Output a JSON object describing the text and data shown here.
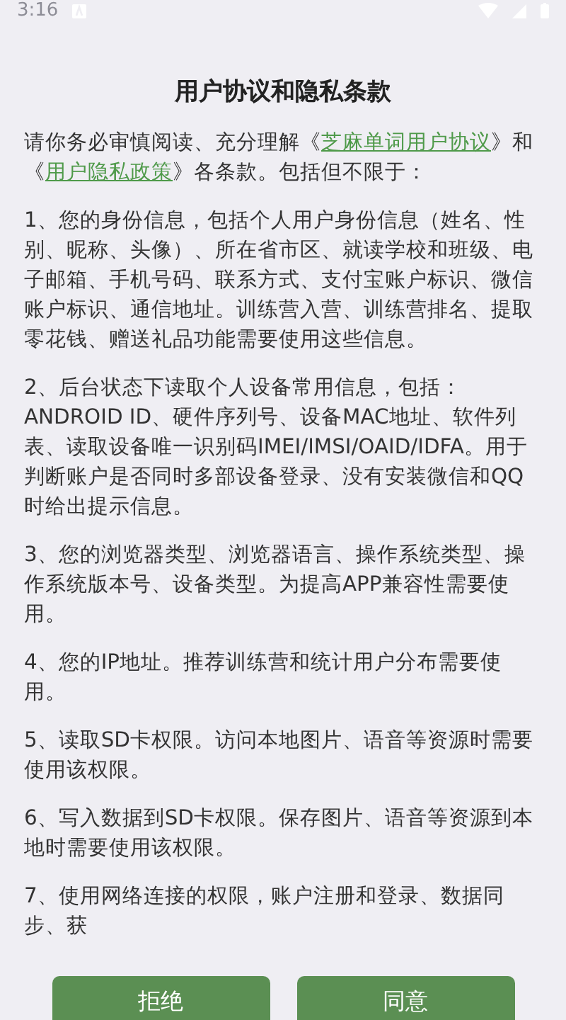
{
  "status_bar": {
    "time": "3:16"
  },
  "title": "用户协议和隐私条款",
  "intro": [
    {
      "kind": "text",
      "text": "请你务必审慎阅读、充分理解《"
    },
    {
      "kind": "link",
      "text": "芝麻单词用户协议"
    },
    {
      "kind": "text",
      "text": "》和《"
    },
    {
      "kind": "link",
      "text": "用户隐私政策"
    },
    {
      "kind": "text",
      "text": "》各条款。包括但不限于："
    }
  ],
  "paragraphs": [
    "1、您的身份信息，包括个人用户身份信息（姓名、性别、昵称、头像）、所在省市区、就读学校和班级、电子邮箱、手机号码、联系方式、支付宝账户标识、微信账户标识、通信地址。训练营入营、训练营排名、提取零花钱、赠送礼品功能需要使用这些信息。",
    "2、后台状态下读取个人设备常用信息，包括：ANDROID ID、硬件序列号、设备MAC地址、软件列表、读取设备唯一识别码IMEI/IMSI/OAID/IDFA。用于判断账户是否同时多部设备登录、没有安装微信和QQ时给出提示信息。",
    "3、您的浏览器类型、浏览器语言、操作系统类型、操作系统版本号、设备类型。为提高APP兼容性需要使用。",
    "4、您的IP地址。推荐训练营和统计用户分布需要使用。",
    "5、读取SD卡权限。访问本地图片、语音等资源时需要使用该权限。",
    "6、写入数据到SD卡权限。保存图片、语音等资源到本地时需要使用该权限。",
    "7、使用网络连接的权限，账户注册和登录、数据同步、获"
  ],
  "buttons": [
    {
      "label": "拒绝"
    },
    {
      "label": "同意"
    }
  ]
}
